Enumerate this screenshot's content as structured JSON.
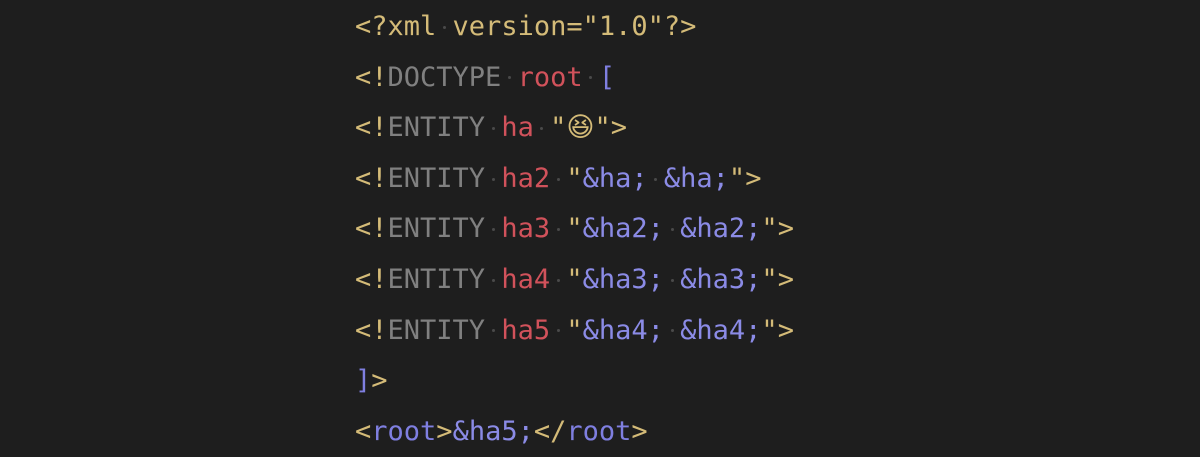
{
  "editor": {
    "lines": [
      [
        {
          "t": "<?",
          "c": "punct"
        },
        {
          "t": "xml",
          "c": "punct"
        },
        {
          "t": " ",
          "c": "ws"
        },
        {
          "t": "version=\"1.0\"",
          "c": "string"
        },
        {
          "t": "?>",
          "c": "punct"
        }
      ],
      [
        {
          "t": "<!",
          "c": "punct"
        },
        {
          "t": "DOCTYPE",
          "c": "keyword"
        },
        {
          "t": " ",
          "c": "ws"
        },
        {
          "t": "root",
          "c": "name"
        },
        {
          "t": " ",
          "c": "ws"
        },
        {
          "t": "[",
          "c": "bracket"
        }
      ],
      [
        {
          "t": "<!",
          "c": "punct"
        },
        {
          "t": "ENTITY",
          "c": "keyword"
        },
        {
          "t": " ",
          "c": "ws"
        },
        {
          "t": "ha",
          "c": "name"
        },
        {
          "t": " ",
          "c": "ws"
        },
        {
          "t": "\"",
          "c": "string"
        },
        {
          "t": "😆",
          "c": "emoji"
        },
        {
          "t": "\"",
          "c": "string"
        },
        {
          "t": ">",
          "c": "punct"
        }
      ],
      [
        {
          "t": "<!",
          "c": "punct"
        },
        {
          "t": "ENTITY",
          "c": "keyword"
        },
        {
          "t": " ",
          "c": "ws"
        },
        {
          "t": "ha2",
          "c": "name"
        },
        {
          "t": " ",
          "c": "ws"
        },
        {
          "t": "\"",
          "c": "string"
        },
        {
          "t": "&ha;",
          "c": "entity"
        },
        {
          "t": " ",
          "c": "ws"
        },
        {
          "t": "&ha;",
          "c": "entity"
        },
        {
          "t": "\"",
          "c": "string"
        },
        {
          "t": ">",
          "c": "punct"
        }
      ],
      [
        {
          "t": "<!",
          "c": "punct"
        },
        {
          "t": "ENTITY",
          "c": "keyword"
        },
        {
          "t": " ",
          "c": "ws"
        },
        {
          "t": "ha3",
          "c": "name"
        },
        {
          "t": " ",
          "c": "ws"
        },
        {
          "t": "\"",
          "c": "string"
        },
        {
          "t": "&ha2;",
          "c": "entity"
        },
        {
          "t": " ",
          "c": "ws"
        },
        {
          "t": "&ha2;",
          "c": "entity"
        },
        {
          "t": "\"",
          "c": "string"
        },
        {
          "t": ">",
          "c": "punct"
        }
      ],
      [
        {
          "t": "<!",
          "c": "punct"
        },
        {
          "t": "ENTITY",
          "c": "keyword"
        },
        {
          "t": " ",
          "c": "ws"
        },
        {
          "t": "ha4",
          "c": "name"
        },
        {
          "t": " ",
          "c": "ws"
        },
        {
          "t": "\"",
          "c": "string"
        },
        {
          "t": "&ha3;",
          "c": "entity"
        },
        {
          "t": " ",
          "c": "ws"
        },
        {
          "t": "&ha3;",
          "c": "entity"
        },
        {
          "t": "\"",
          "c": "string"
        },
        {
          "t": ">",
          "c": "punct"
        }
      ],
      [
        {
          "t": "<!",
          "c": "punct"
        },
        {
          "t": "ENTITY",
          "c": "keyword"
        },
        {
          "t": " ",
          "c": "ws"
        },
        {
          "t": "ha5",
          "c": "name"
        },
        {
          "t": " ",
          "c": "ws"
        },
        {
          "t": "\"",
          "c": "string"
        },
        {
          "t": "&ha4;",
          "c": "entity"
        },
        {
          "t": " ",
          "c": "ws"
        },
        {
          "t": "&ha4;",
          "c": "entity"
        },
        {
          "t": "\"",
          "c": "string"
        },
        {
          "t": ">",
          "c": "punct"
        }
      ],
      [
        {
          "t": "]",
          "c": "bracket"
        },
        {
          "t": ">",
          "c": "punct"
        }
      ],
      [
        {
          "t": "<",
          "c": "punct"
        },
        {
          "t": "root",
          "c": "tag"
        },
        {
          "t": ">",
          "c": "punct"
        },
        {
          "t": "&ha5;",
          "c": "entity"
        },
        {
          "t": "</",
          "c": "punct"
        },
        {
          "t": "root",
          "c": "tag"
        },
        {
          "t": ">",
          "c": "punct"
        }
      ]
    ]
  },
  "theme": {
    "background": "#1e1e1e",
    "punct": "#d4bb78",
    "keyword": "#808080",
    "name": "#d1525b",
    "entity": "#8b8be6",
    "bracket": "#7f7fe0",
    "whitespace_dot": "#4a4a4a"
  }
}
